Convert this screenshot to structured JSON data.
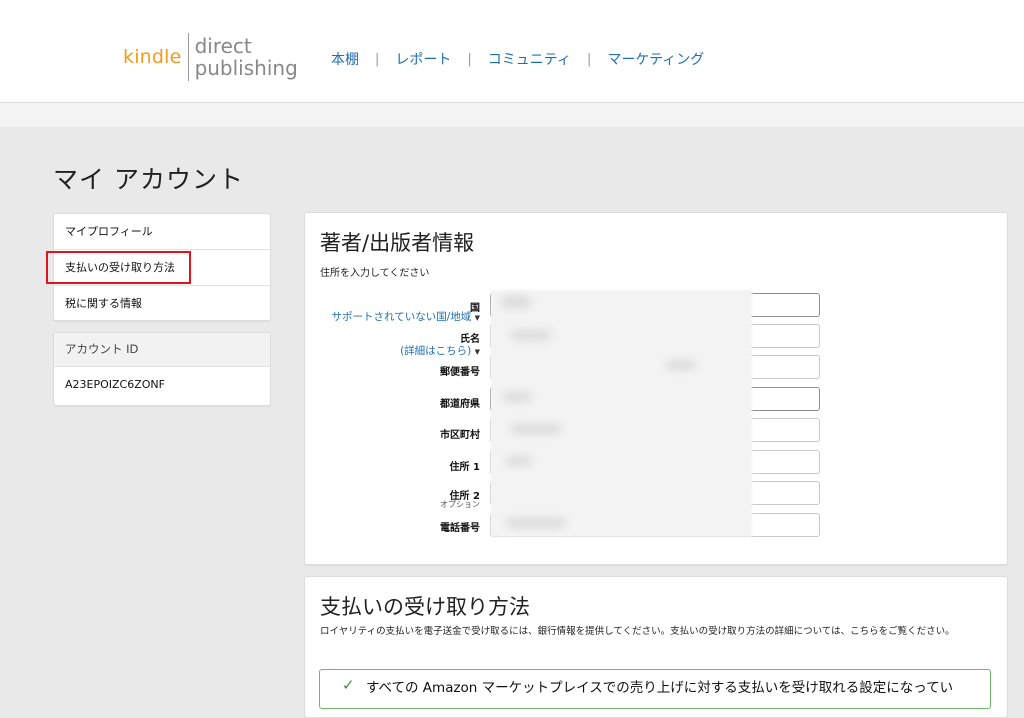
{
  "header": {
    "logo_kindle": "kindle",
    "logo_direct": "direct",
    "logo_publishing": "publishing",
    "nav": [
      "本棚",
      "レポート",
      "コミュニティ",
      "マーケティング"
    ],
    "nav_separator": "|"
  },
  "page": {
    "title": "マイ アカウント"
  },
  "sidebar": {
    "items": [
      {
        "label": "マイプロフィール"
      },
      {
        "label": "支払いの受け取り方法",
        "highlighted": true
      },
      {
        "label": "税に関する情報"
      }
    ],
    "account": {
      "heading": "アカウント ID",
      "value": "A23EPOIZC6ZONF"
    }
  },
  "author_panel": {
    "title": "著者/出版者情報",
    "subtitle": "住所を入力してください",
    "fields": [
      {
        "label": "国",
        "hint": "サポートされていない国/地域"
      },
      {
        "label": "氏名",
        "hint": "(詳細はこちら)"
      },
      {
        "label": "郵便番号"
      },
      {
        "label": "都道府県"
      },
      {
        "label": "市区町村"
      },
      {
        "label": "住所 1"
      },
      {
        "label": "住所 2",
        "sublabel": "オプション"
      },
      {
        "label": "電話番号"
      }
    ]
  },
  "payment_panel": {
    "title": "支払いの受け取り方法",
    "description": "ロイヤリティの支払いを電子送金で受け取るには、銀行情報を提供してください。支払いの受け取り方法の詳細については、こちらをご覧ください。",
    "notice": "すべての Amazon マーケットプレイスでの売り上げに対する支払いを受け取れる設定になってい"
  },
  "colors": {
    "link": "#1f6fb4",
    "kindle_orange": "#f39a1d",
    "highlight_red": "#e0141e",
    "success_green": "#6fb86a"
  },
  "icons": {
    "caret": "caret-down-icon",
    "check": "check-icon"
  }
}
